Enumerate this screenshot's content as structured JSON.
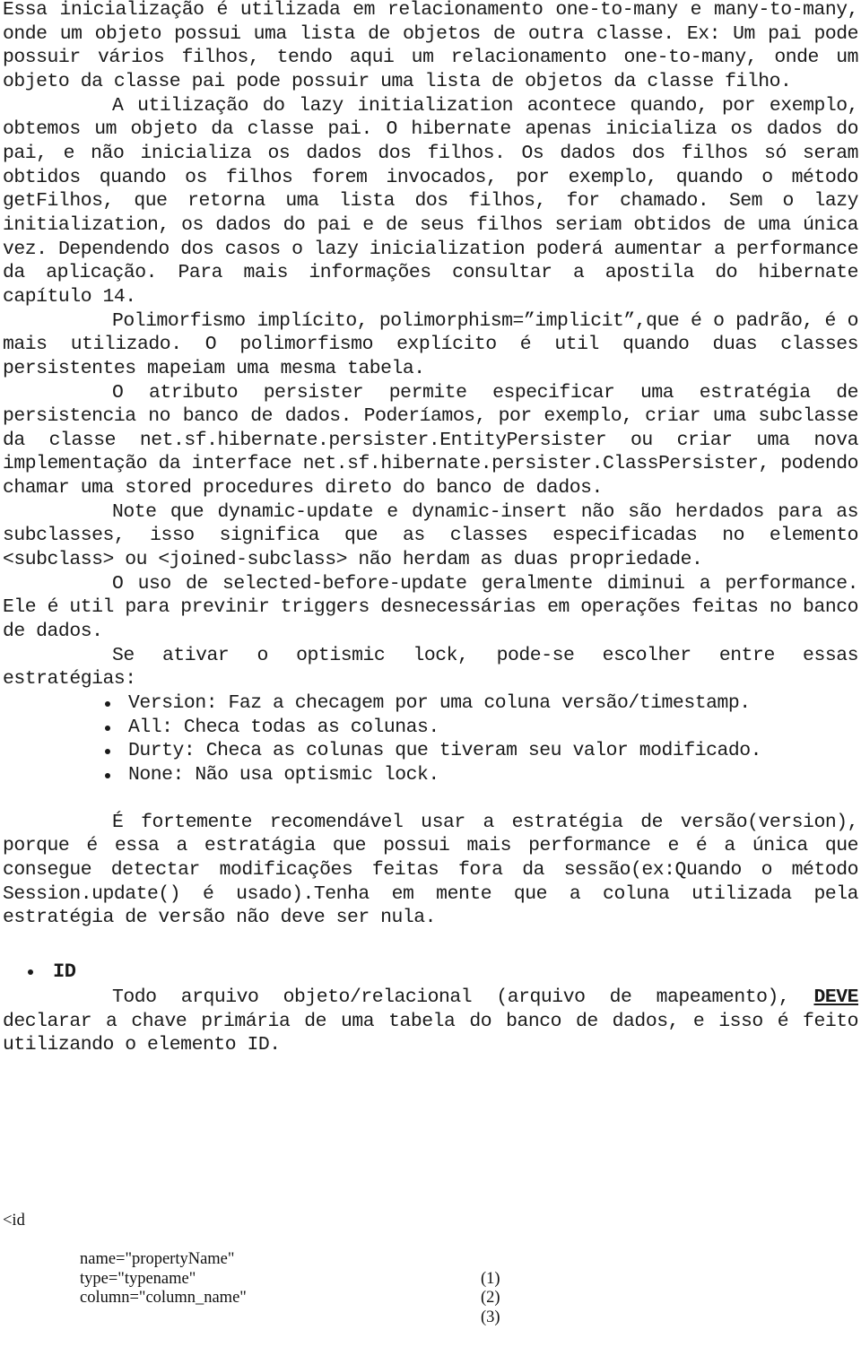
{
  "document": {
    "paragraphs": [
      {
        "id": "p1",
        "indent": false,
        "text": "Essa inicialização é utilizada em relacionamento one-to-many e many-to-many, onde um objeto possui uma lista de objetos de outra classe. Ex: Um pai pode possuir vários filhos, tendo aqui um relacionamento one-to-many, onde um objeto da classe pai pode possuir uma lista de objetos da classe filho."
      },
      {
        "id": "p2",
        "indent": true,
        "text": "A utilização do lazy initialization acontece quando, por exemplo, obtemos um objeto da classe pai. O hibernate apenas inicializa os dados do pai, e não inicializa os dados dos filhos. Os dados dos filhos só seram obtidos quando os filhos forem invocados,  por exemplo, quando o método getFilhos, que retorna uma lista dos filhos, for chamado. Sem o lazy  initialization, os dados do pai e de seus filhos seriam obtidos de uma única vez. Dependendo dos casos o lazy inicialization poderá aumentar a performance da aplicação. Para mais informações consultar a apostila do hibernate capítulo 14."
      },
      {
        "id": "p3",
        "indent": true,
        "text": "Polimorfismo implícito, polimorphism=”implicit”,que é o padrão, é o mais utilizado. O polimorfismo explícito é util quando duas classes persistentes mapeiam uma mesma tabela."
      },
      {
        "id": "p4",
        "indent": true,
        "text": "O atributo persister permite especificar uma estratégia de persistencia no banco de dados. Poderíamos, por exemplo, criar uma subclasse da classe net.sf.hibernate.persister.EntityPersister ou criar uma nova implementação da interface net.sf.hibernate.persister.ClassPersister, podendo chamar uma stored procedures direto do banco de dados."
      },
      {
        "id": "p5",
        "indent": true,
        "text": "Note que dynamic-update e dynamic-insert não são herdados para as subclasses, isso significa que as classes especificadas no elemento <subclass> ou <joined-subclass> não herdam as duas propriedade."
      },
      {
        "id": "p6",
        "indent": true,
        "text": "O uso de selected-before-update geralmente diminui a performance. Ele é util para previnir triggers desnecessárias em operações feitas no banco de dados."
      },
      {
        "id": "p7",
        "indent": true,
        "text": "Se ativar o optismic lock, pode-se escolher entre essas estratégias:"
      }
    ],
    "lock_strategies": [
      "Version: Faz a checagem por uma coluna versão/timestamp.",
      "All: Checa todas as colunas.",
      "Durty: Checa as colunas que tiveram seu valor modificado.",
      "None: Não usa optismic lock."
    ],
    "recommendation": "É fortemente recomendável usar a estratégia de versão(version), porque é essa a estratágia que possui mais performance e é a única que consegue detectar modificações feitas fora da sessão(ex:Quando o método Session.update() é usado).Tenha em mente que a coluna utilizada pela estratégia de versão não deve ser nula.",
    "section": {
      "heading": "ID",
      "intro_text": "Todo arquivo objeto/relacional (arquivo de mapeamento),",
      "emphasis": "DEVE",
      "rest_text": " declarar a chave primária de uma tabela do banco de dados, e isso é feito utilizando o elemento ID."
    },
    "code": {
      "open_tag": "<id",
      "lines": [
        {
          "attr": "name=\"propertyName\"",
          "num": "(1)"
        },
        {
          "attr": "type=\"typename\"",
          "num": "(2)"
        },
        {
          "attr": "column=\"column_name\"",
          "num": "(3)"
        }
      ]
    }
  }
}
